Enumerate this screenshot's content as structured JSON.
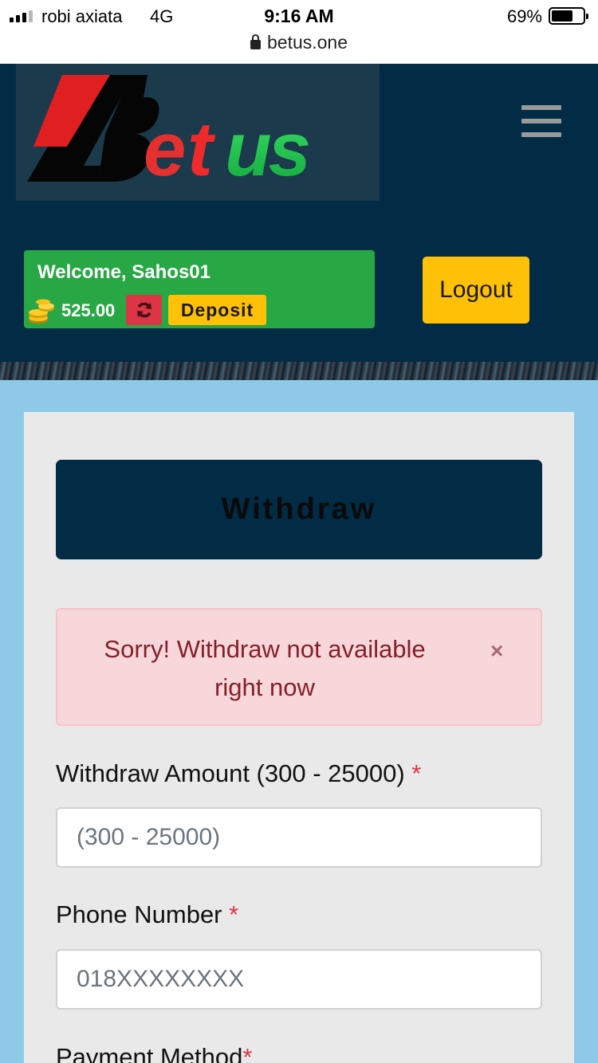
{
  "status_bar": {
    "carrier": "robi axiata",
    "network": "4G",
    "time": "9:16 AM",
    "battery_pct": "69%",
    "battery_level": 0.69,
    "url": "betus.one"
  },
  "header": {
    "logo_text": "Betus",
    "welcome": "Welcome, Sahos01",
    "balance": "525.00",
    "deposit_label": "Deposit",
    "logout_label": "Logout"
  },
  "withdraw": {
    "title": "Withdraw",
    "alert_message": "Sorry! Withdraw not available right now",
    "alert_close": "×",
    "required_mark": "*",
    "amount_label": "Withdraw Amount (300 - 25000)",
    "amount_placeholder": "(300 - 25000)",
    "phone_label": "Phone Number",
    "phone_placeholder": "018XXXXXXXX",
    "payment_label": "Payment Method"
  },
  "colors": {
    "header_bg": "#022b45",
    "page_bg": "#8ec9e8",
    "success_green": "#28a745",
    "warning_yellow": "#ffc107",
    "danger_red": "#dc3545"
  }
}
